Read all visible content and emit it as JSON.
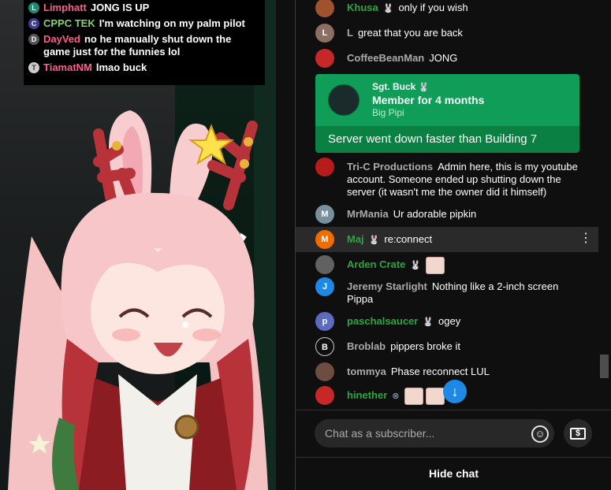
{
  "overlay_chat": [
    {
      "name": "Limphatt",
      "name_color": "#ff5d8f",
      "avatar": "L",
      "avatar_color": "#1f8a70",
      "text": "JONG IS UP"
    },
    {
      "name": "CPPC TEK",
      "name_color": "#8ad16f",
      "avatar": "C",
      "avatar_color": "#3b3f8c",
      "text": "I'm watching on my palm pilot"
    },
    {
      "name": "DayVed",
      "name_color": "#ff5d8f",
      "avatar": "D",
      "avatar_color": "#555555",
      "text": "no he manually shut down the game just for the funnies lol"
    },
    {
      "name": "TiamatNM",
      "name_color": "#ff5d8f",
      "avatar": "T",
      "avatar_color": "#cccccc",
      "text": "lmao buck"
    }
  ],
  "chat": {
    "messages": [
      {
        "author": "Khusa",
        "member": true,
        "badge": "bunny-badge",
        "text": "only if you wish",
        "avatar": "",
        "avatar_color": "#a0522d"
      },
      {
        "author": "L",
        "member": false,
        "text": "great that you are back",
        "avatar": "L",
        "avatar_color": "#8d6e63"
      },
      {
        "author": "CoffeeBeanMan",
        "member": false,
        "text": "JONG",
        "avatar": "",
        "avatar_color": "#c62828"
      },
      {
        "author": "Tri-C Productions",
        "member": false,
        "text": "Admin here, this is my youtube account. Someone ended up shutting down the server (it wasn't me the owner did it himself)",
        "avatar": "",
        "avatar_color": "#b71c1c"
      },
      {
        "author": "MrMania",
        "member": false,
        "text": "Ur adorable pipkin",
        "avatar": "M",
        "avatar_color": "#78909c"
      },
      {
        "author": "Maj",
        "member": true,
        "badge": "bunny-badge",
        "text": "re:connect",
        "avatar": "M",
        "avatar_color": "#ef6c00"
      },
      {
        "author": "Arden Crate",
        "member": true,
        "badge": "bunny-badge",
        "text": "",
        "avatar": "",
        "avatar_color": "#616161"
      },
      {
        "author": "Jeremy Starlight",
        "member": false,
        "text": "Nothing like a 2-inch screen Pippa",
        "avatar": "J",
        "avatar_color": "#1e88e5"
      },
      {
        "author": "paschalsaucer",
        "member": true,
        "badge": "bunny-badge",
        "text": "ogey",
        "avatar": "p",
        "avatar_color": "#5c6bc0"
      },
      {
        "author": "Broblab",
        "member": false,
        "text": "pippers broke it",
        "avatar": "B",
        "avatar_color": "#0f0f0f"
      },
      {
        "author": "tommya",
        "member": false,
        "text": "Phase reconnect LUL",
        "avatar": "",
        "avatar_color": "#6d4c41"
      },
      {
        "author": "hinether",
        "member": true,
        "badge": "verified-badge",
        "text": "",
        "avatar": "",
        "avatar_color": "#c62828"
      }
    ],
    "membership": {
      "author": "Sgt. Buck",
      "headline": "Member for 4 months",
      "sub": "Big Pipi",
      "message": "Server went down faster than Building 7",
      "bg_top": "#0f9d58",
      "bg_bottom": "#0a8043"
    },
    "input_placeholder": "Chat as a subscriber...",
    "hide_chat_label": "Hide chat"
  }
}
